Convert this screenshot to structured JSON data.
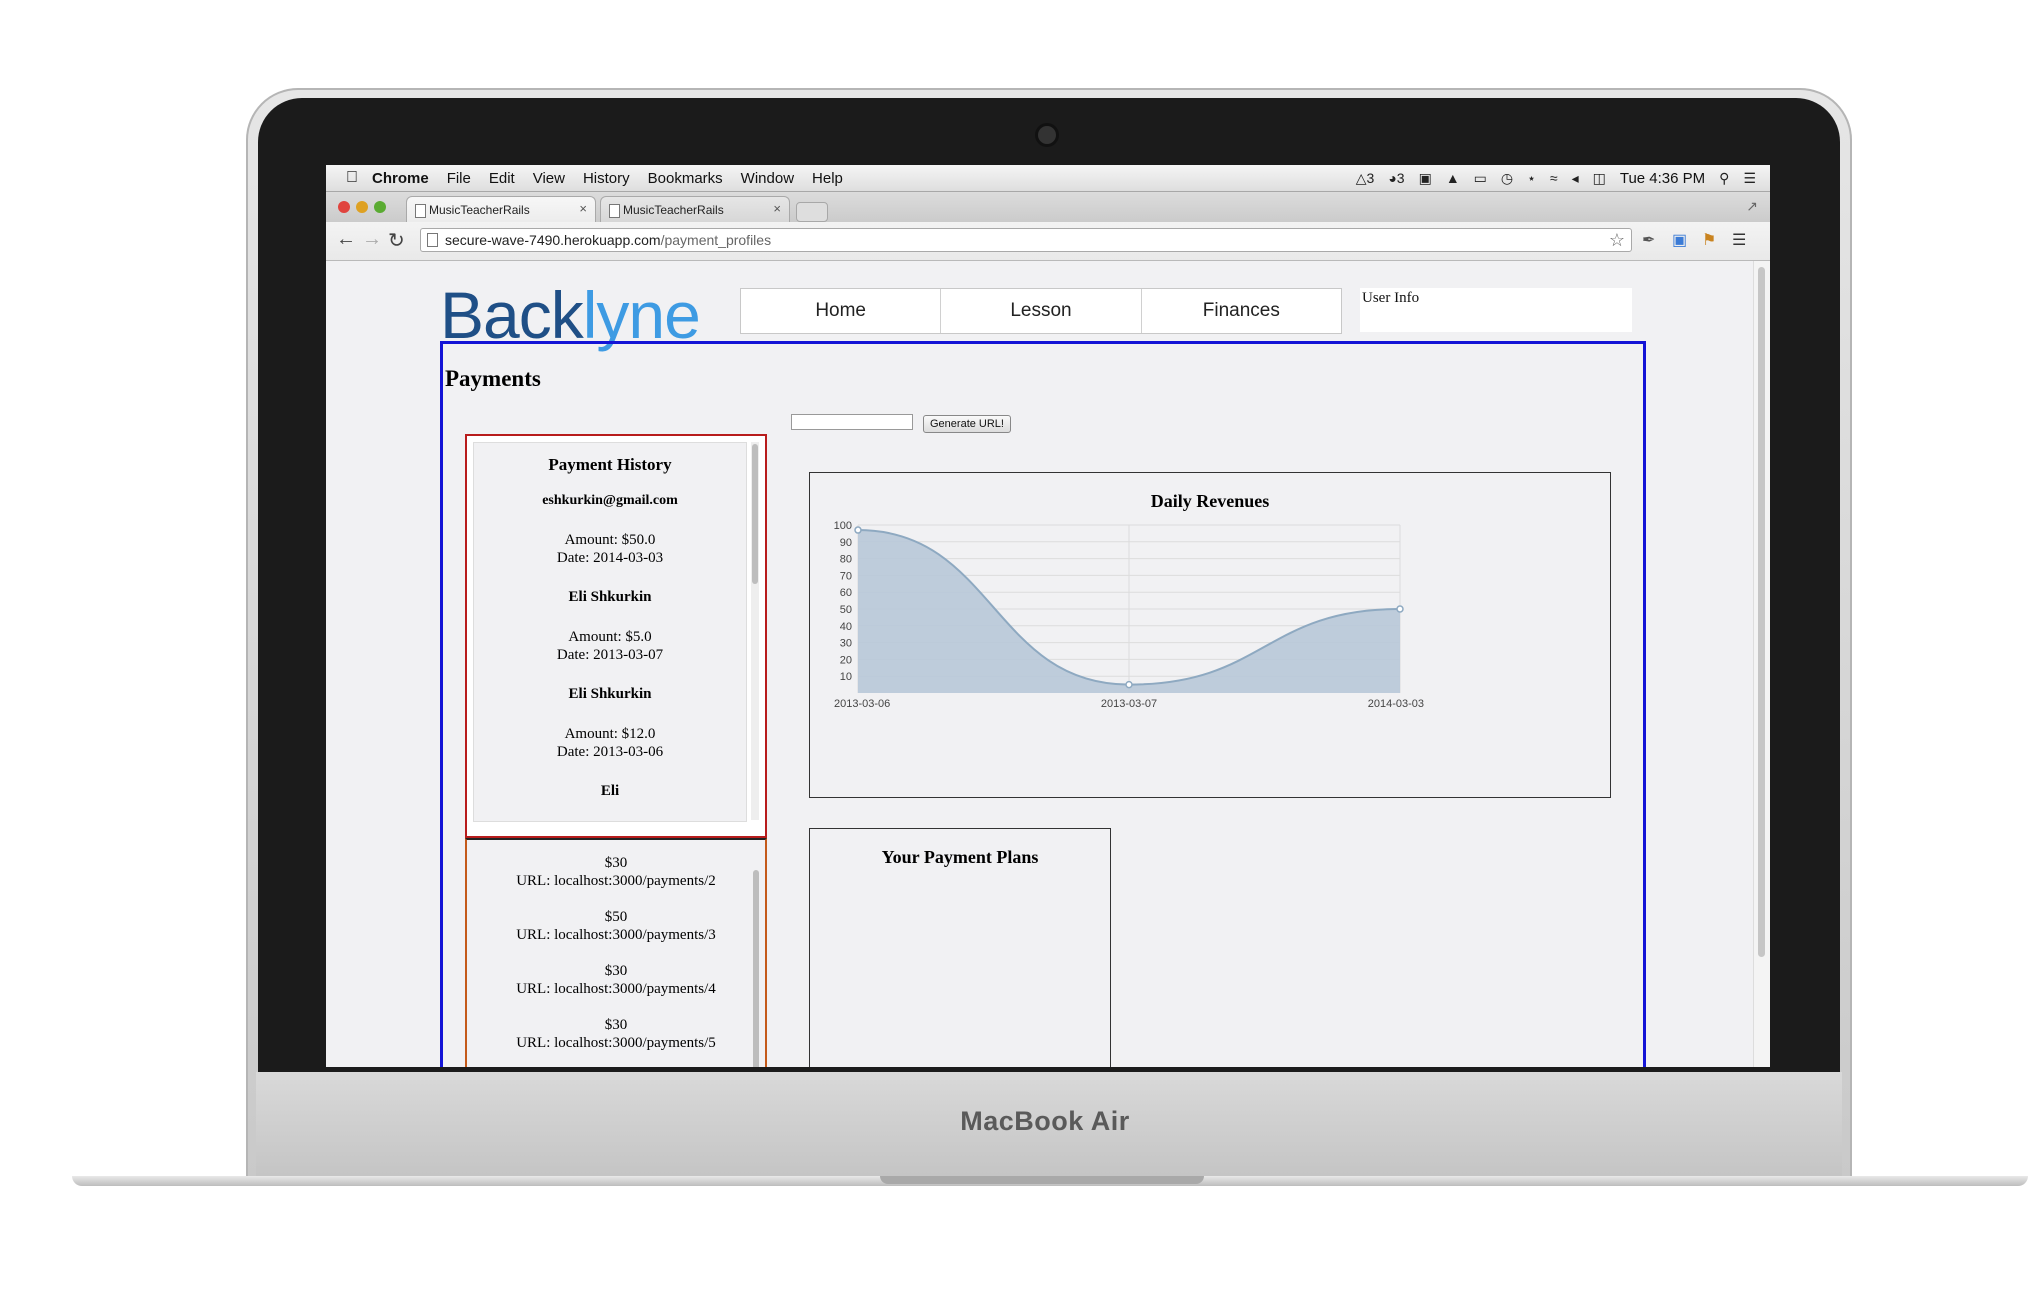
{
  "device": {
    "label": "MacBook Air"
  },
  "menubar": {
    "app": "Chrome",
    "items": [
      "File",
      "Edit",
      "View",
      "History",
      "Bookmarks",
      "Window",
      "Help"
    ],
    "status_counts": [
      "3",
      "3"
    ],
    "clock": "Tue 4:36 PM"
  },
  "tabs": [
    {
      "label": "MusicTeacherRails"
    },
    {
      "label": "MusicTeacherRails"
    }
  ],
  "address_bar": {
    "host": "secure-wave-7490.herokuapp.com",
    "path": "/payment_profiles"
  },
  "site": {
    "logo_primary": "Back",
    "logo_accent": "lyne",
    "nav": [
      "Home",
      "Lesson",
      "Finances"
    ],
    "user_info": "User Info"
  },
  "page": {
    "title": "Payments",
    "generate_button": "Generate URL!",
    "url_input_value": ""
  },
  "payment_history": {
    "title": "Payment History",
    "entries": [
      {
        "who": "eshkurkin@gmail.com",
        "amount": "Amount: $50.0",
        "date": "Date: 2014-03-03"
      },
      {
        "who": "Eli Shkurkin",
        "amount": "Amount: $5.0",
        "date": "Date: 2013-03-07"
      },
      {
        "who": "Eli Shkurkin",
        "amount": "Amount: $12.0",
        "date": "Date: 2013-03-06"
      },
      {
        "who": "Eli"
      }
    ]
  },
  "payment_urls": [
    {
      "price": "$30",
      "url": "URL: localhost:3000/payments/2"
    },
    {
      "price": "$50",
      "url": "URL: localhost:3000/payments/3"
    },
    {
      "price": "$30",
      "url": "URL: localhost:3000/payments/4"
    },
    {
      "price": "$30",
      "url": "URL: localhost:3000/payments/5"
    }
  ],
  "payment_plans": {
    "title": "Your Payment Plans"
  },
  "chart_data": {
    "type": "area",
    "title": "Daily Revenues",
    "categories": [
      "2013-03-06",
      "2013-03-07",
      "2014-03-03"
    ],
    "series": [
      {
        "values": [
          97,
          5,
          50
        ]
      }
    ],
    "ylim": [
      0,
      100
    ],
    "yticks": [
      10,
      20,
      30,
      40,
      50,
      60,
      70,
      80,
      90,
      100
    ],
    "grid": true,
    "fill_color": "#b8c8d8",
    "line_color": "#8ea9c1"
  },
  "colors": {
    "content_border": "#1414d6",
    "history_border": "#b81c1c",
    "logo_primary": "#1f4f86",
    "logo_accent": "#3e9be3"
  }
}
